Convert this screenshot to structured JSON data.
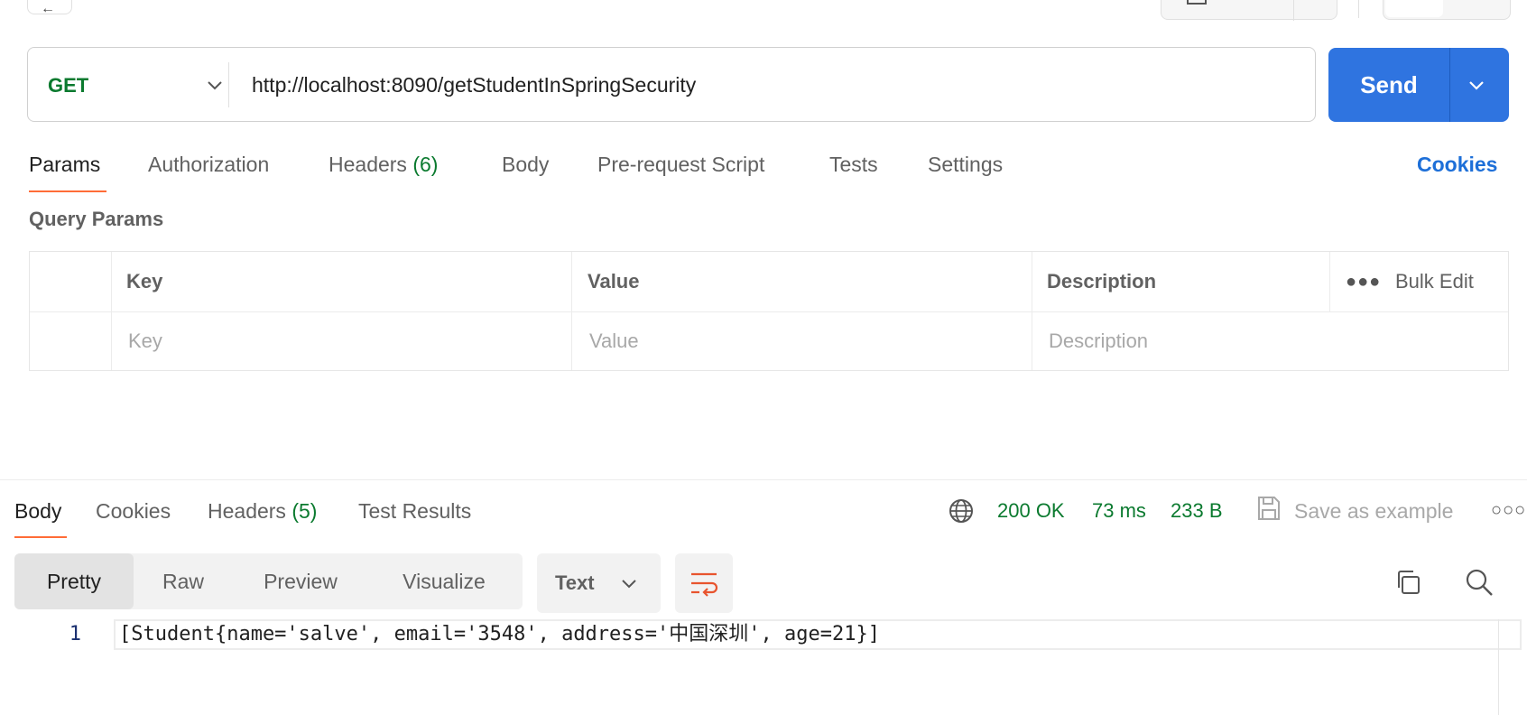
{
  "request": {
    "method": "GET",
    "url": "http://localhost:8090/getStudentInSpringSecurity",
    "send_label": "Send",
    "tabs": [
      {
        "label": "Params",
        "count": ""
      },
      {
        "label": "Authorization",
        "count": ""
      },
      {
        "label": "Headers",
        "count": "(6)"
      },
      {
        "label": "Body",
        "count": ""
      },
      {
        "label": "Pre-request Script",
        "count": ""
      },
      {
        "label": "Tests",
        "count": ""
      },
      {
        "label": "Settings",
        "count": ""
      }
    ],
    "cookies_label": "Cookies"
  },
  "query_params": {
    "title": "Query Params",
    "headers": {
      "key": "Key",
      "value": "Value",
      "description": "Description"
    },
    "bulk_edit_label": "Bulk Edit",
    "placeholders": {
      "key": "Key",
      "value": "Value",
      "description": "Description"
    }
  },
  "response": {
    "tabs": [
      {
        "label": "Body",
        "count": ""
      },
      {
        "label": "Cookies",
        "count": ""
      },
      {
        "label": "Headers",
        "count": "(5)"
      },
      {
        "label": "Test Results",
        "count": ""
      }
    ],
    "status": "200 OK",
    "time": "73 ms",
    "size": "233 B",
    "save_label": "Save as example",
    "views": [
      "Pretty",
      "Raw",
      "Preview",
      "Visualize"
    ],
    "format": "Text",
    "lines": [
      {
        "number": "1",
        "text": "[Student{name='salve', email='3548', address='中国深圳', age=21}]"
      }
    ]
  },
  "colors": {
    "accent": "#ff6c37",
    "send": "#2f74e0",
    "success": "#0b7a2f",
    "link": "#1d6fd8"
  },
  "icons": [
    "back-arrow-icon",
    "chevron-down-icon",
    "globe-icon",
    "save-icon",
    "more-horizontal-icon",
    "wrap-lines-icon",
    "copy-icon",
    "search-icon"
  ]
}
